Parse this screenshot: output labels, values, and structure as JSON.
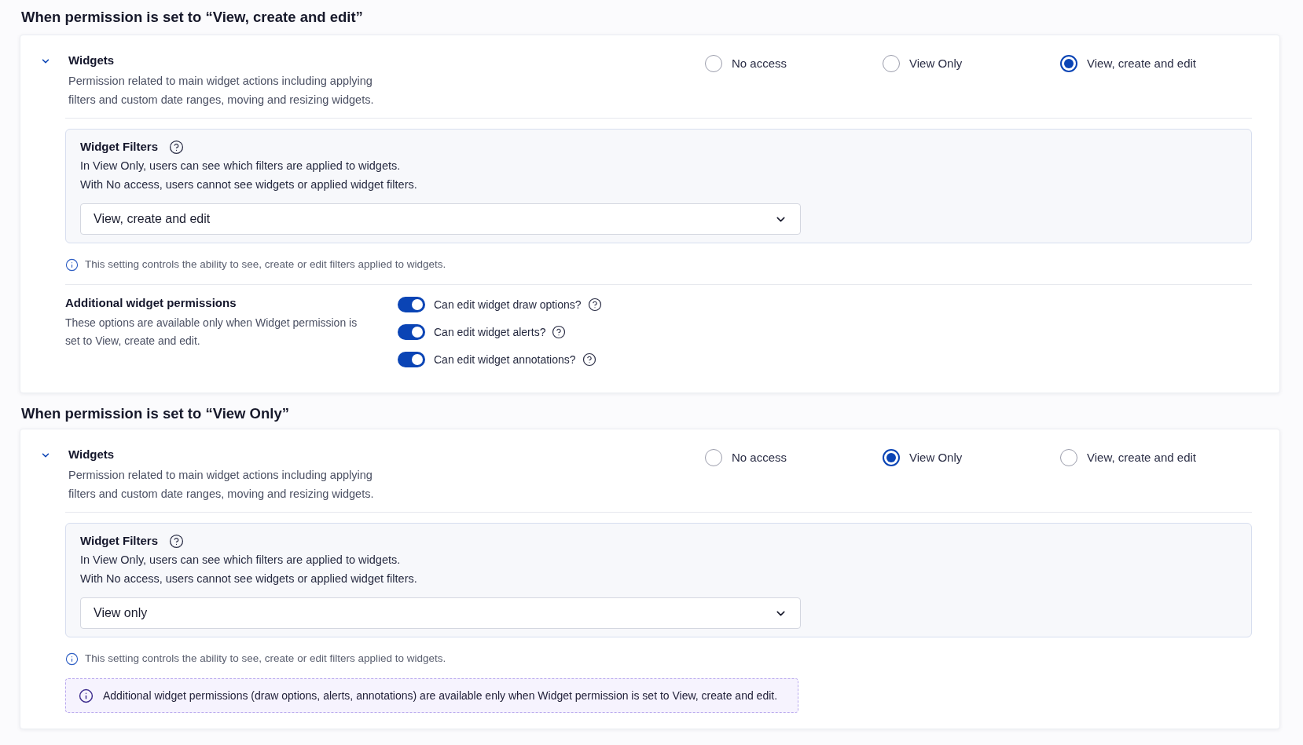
{
  "sections": [
    {
      "heading": "When permission is set to “View, create and edit”",
      "permission": {
        "title": "Widgets",
        "expanded": true,
        "description": "Permission related to main widget actions including applying filters and custom date ranges, moving and resizing widgets.",
        "options": [
          {
            "label": "No access",
            "selected": false
          },
          {
            "label": "View Only",
            "selected": false
          },
          {
            "label": "View, create and edit",
            "selected": true
          }
        ]
      },
      "filters": {
        "title": "Widget Filters",
        "description": [
          "In View Only, users can see which filters are applied to widgets.",
          "With No access, users cannot see widgets or applied widget filters."
        ],
        "select": {
          "value": "View, create and edit"
        }
      },
      "info": "This setting controls the ability to see, create or edit filters applied to widgets.",
      "extra": {
        "kind": "toggles",
        "title": "Additional widget permissions",
        "description": "These options are available only when Widget permission is set to View, create and edit.",
        "toggles": [
          {
            "label": "Can edit widget draw options?",
            "on": true
          },
          {
            "label": "Can edit widget alerts?",
            "on": true
          },
          {
            "label": "Can edit widget annotations?",
            "on": true
          }
        ]
      }
    },
    {
      "heading": "When permission is set to “View Only”",
      "permission": {
        "title": "Widgets",
        "expanded": true,
        "description": "Permission related to main widget actions including applying filters and custom date ranges, moving and resizing widgets.",
        "options": [
          {
            "label": "No access",
            "selected": false
          },
          {
            "label": "View Only",
            "selected": true
          },
          {
            "label": "View, create and edit",
            "selected": false
          }
        ]
      },
      "filters": {
        "title": "Widget Filters",
        "description": [
          "In View Only, users can see which filters are applied to widgets.",
          "With No access, users cannot see widgets or applied widget filters."
        ],
        "select": {
          "value": "View only"
        }
      },
      "info": "This setting controls the ability to see, create or edit filters applied to widgets.",
      "extra": {
        "kind": "note",
        "text": "Additional widget permissions (draw options, alerts, annotations) are available enly when Widget permission is set to View, create and edit."
      }
    }
  ]
}
